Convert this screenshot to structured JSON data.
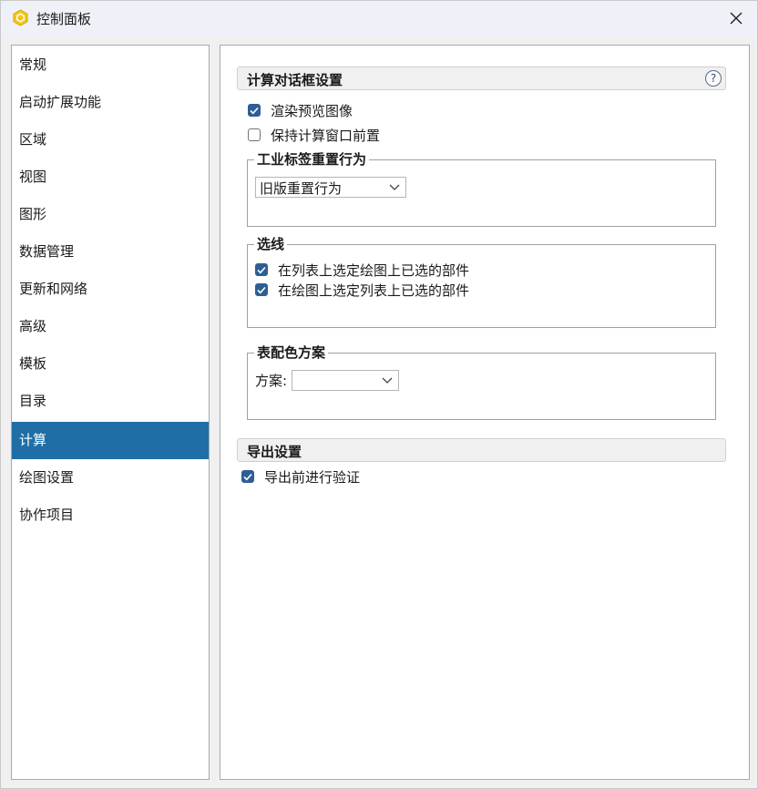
{
  "window": {
    "title": "控制面板"
  },
  "sidebar": {
    "items": [
      {
        "label": "常规"
      },
      {
        "label": "启动扩展功能"
      },
      {
        "label": "区域"
      },
      {
        "label": "视图"
      },
      {
        "label": "图形"
      },
      {
        "label": "数据管理"
      },
      {
        "label": "更新和网络"
      },
      {
        "label": "高级"
      },
      {
        "label": "模板"
      },
      {
        "label": "目录"
      },
      {
        "label": "计算",
        "selected": true
      },
      {
        "label": "绘图设置"
      },
      {
        "label": "协作项目"
      }
    ]
  },
  "calc_dialog": {
    "title": "计算对话框设置",
    "help_glyph": "?",
    "render_preview": {
      "label": "渲染预览图像",
      "checked": true
    },
    "keep_front": {
      "label": "保持计算窗口前置",
      "checked": false
    }
  },
  "industry_label_reset": {
    "title": "工业标签重置行为",
    "selected": "旧版重置行为"
  },
  "line_selection": {
    "title": "选线",
    "list_to_drawing": {
      "label": "在列表上选定绘图上已选的部件",
      "checked": true
    },
    "drawing_to_list": {
      "label": "在绘图上选定列表上已选的部件",
      "checked": true
    }
  },
  "table_color_scheme": {
    "title": "表配色方案",
    "scheme_label": "方案:",
    "selected": ""
  },
  "export_settings": {
    "title": "导出设置",
    "validate_before_export": {
      "label": "导出前进行验证",
      "checked": true
    }
  },
  "colors": {
    "accent": "#1f6fa6",
    "checkbox": "#2d5f95",
    "app_icon": "#f5c518"
  }
}
